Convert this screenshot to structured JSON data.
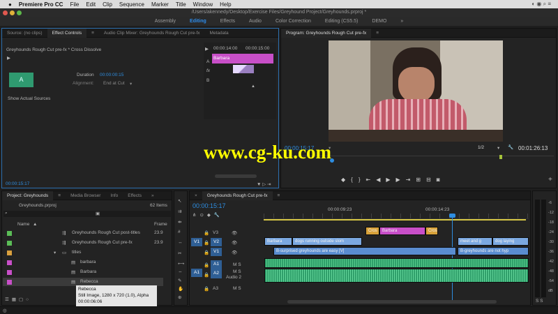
{
  "menubar": {
    "app": "Premiere Pro CC",
    "items": [
      "File",
      "Edit",
      "Clip",
      "Sequence",
      "Marker",
      "Title",
      "Window",
      "Help"
    ]
  },
  "path_title": "/Users/akennedy/Desktop/Exercise Files/Greyhound Project/Greyhounds.prproj *",
  "workspaces": [
    "Assembly",
    "Editing",
    "Effects",
    "Audio",
    "Color Correction",
    "Editing (CS5.5)",
    "DEMO"
  ],
  "active_workspace": "Editing",
  "source_panel": {
    "tabs": [
      "Source: (no clips)",
      "Effect Controls",
      "Audio Clip Mixer: Greyhounds Rough Cut pre-fx",
      "Metadata"
    ],
    "effect_title": "Greyhounds Rough Cut pre-fx * Cross Dissolve",
    "duration_label": "Duration",
    "duration_value": "00:00:00:15",
    "alignment_label": "Alignment:",
    "alignment_value": "End at Cut",
    "show_sources": "Show Actual Sources",
    "mini_tc1": "00:00:14:00",
    "mini_tc2": "00:00:15:00",
    "mini_clip": "Barbara",
    "track_a": "A",
    "track_b": "B",
    "timecode": "00:00:15:17"
  },
  "program_panel": {
    "title": "Program: Greyhounds Rough Cut pre-fx",
    "timecode": "00:00:15:17",
    "resolution": "1/2",
    "duration": "00:01:26:13"
  },
  "watermark": "www.cg-ku.com",
  "project_panel": {
    "tabs": [
      "Project: Greyhounds",
      "Media Browser",
      "Info",
      "Effects"
    ],
    "file": "Greyhounds.prproj",
    "count": "62 Items",
    "col_name": "Name",
    "col_frame": "Frame",
    "items": [
      {
        "name": "Greyhounds Rough Cut post-titles",
        "rate": "23.9",
        "color": "#5bbd57"
      },
      {
        "name": "Greyhounds Rough Cut pre-fx",
        "rate": "23.9",
        "color": "#5bbd57"
      },
      {
        "name": "titles",
        "rate": "",
        "color": "#d9a03e"
      },
      {
        "name": "barbara",
        "rate": "",
        "color": "#c84fc8"
      },
      {
        "name": "Barbara",
        "rate": "",
        "color": "#c84fc8"
      },
      {
        "name": "Rebecca",
        "rate": "",
        "color": "#c84fc8"
      }
    ],
    "tooltip": {
      "name": "Rebecca",
      "info": "Still Image, 1280 x 720 (1.0), Alpha",
      "dur": "00:00:06:06"
    }
  },
  "timeline": {
    "tab": "Greyhounds Rough Cut pre-fx",
    "timecode": "00:00:15:17",
    "ruler": [
      "00:00:09:23",
      "00:00:14:23"
    ],
    "tracks": [
      "V3",
      "V2",
      "V1",
      "A1",
      "A2",
      "A3"
    ],
    "src_patch_v": "V1",
    "src_patch_a": "A1",
    "audio_name": "Audio 2",
    "clips": {
      "v3_a": "Cros",
      "v3_b": "Barbara",
      "v3_c": "Cros",
      "v2_a": "Barbara",
      "v2_b": "dogs running outside slom",
      "v2_c": "meet and g",
      "v2_d": "dog laying",
      "v1_a": "B-surprised greyhounds are easy [V]",
      "v1_b": "B-greyhounds are not hyp"
    }
  },
  "meter": {
    "labels": [
      "-6",
      "-12",
      "-18",
      "-24",
      "-30",
      "-36",
      "-42",
      "-48",
      "-54",
      "dB"
    ],
    "solo": "S S"
  },
  "colors": {
    "accent": "#2e8de0",
    "video": "#7ba8e0",
    "title_clip": "#c84fc8",
    "audio": "#2f9f6a"
  }
}
